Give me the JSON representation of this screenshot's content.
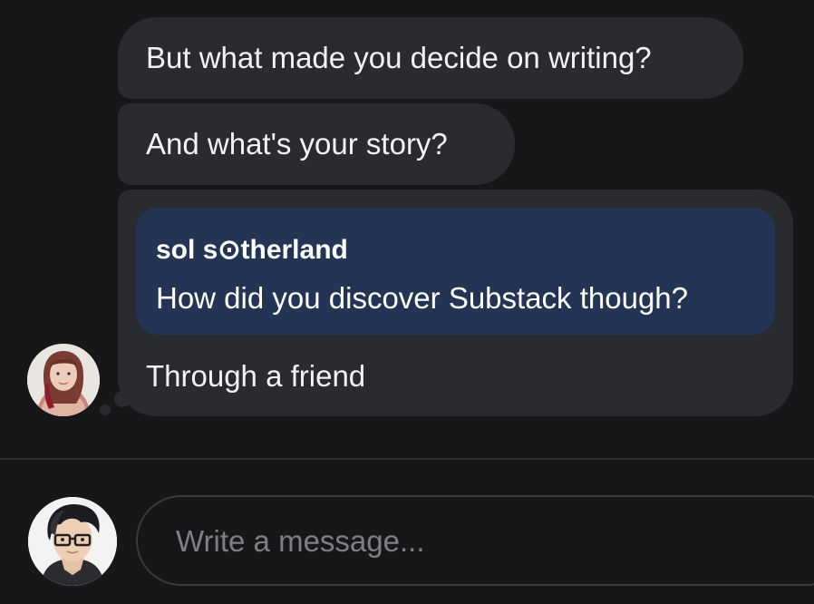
{
  "thread": {
    "messages": [
      {
        "text": "But what made you decide on writing?"
      },
      {
        "text": "And what's your story?"
      }
    ],
    "reply": {
      "quoted_author": "sol s⊙therland",
      "quoted_text": "How did you discover Substack though?",
      "text": "Through a friend"
    }
  },
  "composer": {
    "placeholder": "Write a message..."
  },
  "colors": {
    "background": "#161719",
    "bubble": "#2a2b2e",
    "quote": "#233455"
  }
}
